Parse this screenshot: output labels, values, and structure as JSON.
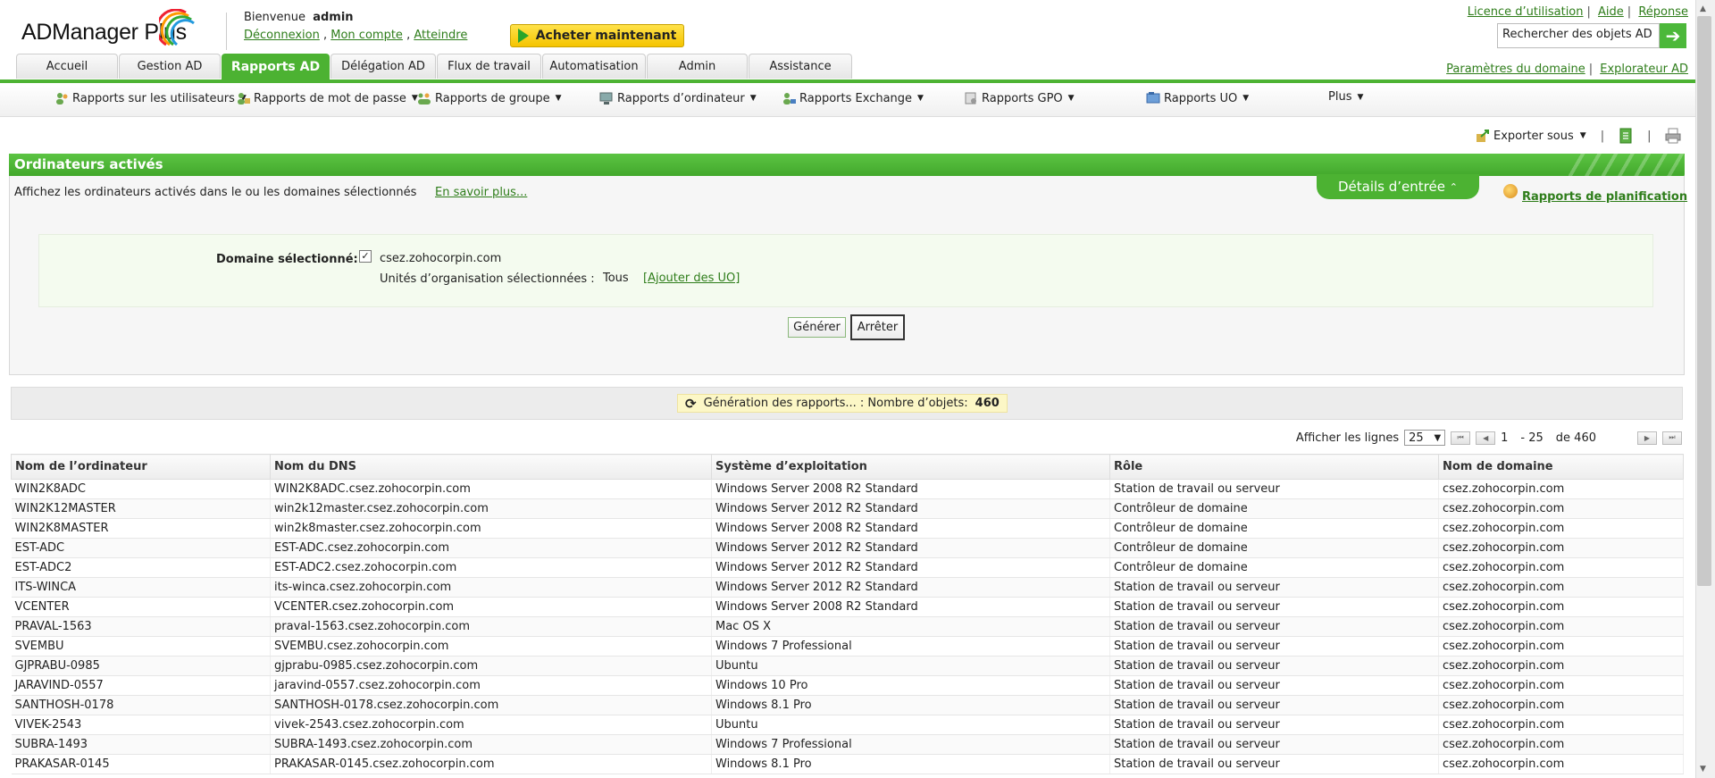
{
  "header": {
    "logo_text": "ADManager Plus",
    "welcome_label": "Bienvenue",
    "username": "admin",
    "user_links": [
      "Déconnexion",
      "Mon compte",
      "Atteindre"
    ],
    "buy_button": "Acheter maintenant",
    "top_links": [
      "Licence d’utilisation",
      "Aide",
      "Réponse"
    ],
    "search_placeholder": "Rechercher des objets AD",
    "domain_links": [
      "Paramètres du domaine",
      "Explorateur AD"
    ]
  },
  "tabs": [
    {
      "label": "Accueil",
      "active": false
    },
    {
      "label": "Gestion AD",
      "active": false
    },
    {
      "label": "Rapports AD",
      "active": true
    },
    {
      "label": "Délégation AD",
      "active": false
    },
    {
      "label": "Flux de travail",
      "active": false
    },
    {
      "label": "Automatisation",
      "active": false
    },
    {
      "label": "Admin",
      "active": false
    },
    {
      "label": "Assistance",
      "active": false
    }
  ],
  "subnav": [
    {
      "label": "Rapports sur les utilisateurs",
      "icon": "users-icon"
    },
    {
      "label": "Rapports de mot de passe",
      "icon": "password-icon"
    },
    {
      "label": "Rapports de groupe",
      "icon": "group-icon"
    },
    {
      "label": "Rapports d’ordinateur",
      "icon": "computer-icon"
    },
    {
      "label": "Rapports Exchange",
      "icon": "exchange-icon"
    },
    {
      "label": "Rapports GPO",
      "icon": "gpo-icon"
    },
    {
      "label": "Rapports UO",
      "icon": "ou-icon"
    },
    {
      "label": "Plus",
      "icon": ""
    }
  ],
  "toolbar": {
    "export_label": "Exporter sous"
  },
  "panel": {
    "title": "Ordinateurs activés",
    "description": "Affichez les ordinateurs activés dans le ou les domaines sélectionnés",
    "learn_more": "En savoir plus...",
    "details_tab": "Détails d’entrée",
    "schedule_link": "Rapports de planification",
    "domain_label": "Domaine sélectionné:",
    "domain_value": "csez.zohocorpin.com",
    "ou_label": "Unités d’organisation sélectionnées :",
    "ou_value": "Tous",
    "ou_link": "[Ajouter des UO]",
    "generate_button": "Générer",
    "stop_button": "Arrêter"
  },
  "status": {
    "text": "Génération des rapports... : Nombre d’objets:",
    "count": "460"
  },
  "paging": {
    "show_rows_label": "Afficher les lignes",
    "rows": "25",
    "from": "1",
    "to": "- 25",
    "total": "de 460"
  },
  "table": {
    "columns": [
      "Nom de l’ordinateur",
      "Nom du DNS",
      "Système d’exploitation",
      "Rôle",
      "Nom de domaine"
    ],
    "rows": [
      [
        "WIN2K8ADC",
        "WIN2K8ADC.csez.zohocorpin.com",
        "Windows Server 2008 R2 Standard",
        "Station de travail ou serveur",
        "csez.zohocorpin.com"
      ],
      [
        "WIN2K12MASTER",
        "win2k12master.csez.zohocorpin.com",
        "Windows Server 2012 R2 Standard",
        "Contrôleur de domaine",
        "csez.zohocorpin.com"
      ],
      [
        "WIN2K8MASTER",
        "win2k8master.csez.zohocorpin.com",
        "Windows Server 2008 R2 Standard",
        "Contrôleur de domaine",
        "csez.zohocorpin.com"
      ],
      [
        "EST-ADC",
        "EST-ADC.csez.zohocorpin.com",
        "Windows Server 2012 R2 Standard",
        "Contrôleur de domaine",
        "csez.zohocorpin.com"
      ],
      [
        "EST-ADC2",
        "EST-ADC2.csez.zohocorpin.com",
        "Windows Server 2012 R2 Standard",
        "Contrôleur de domaine",
        "csez.zohocorpin.com"
      ],
      [
        "ITS-WINCA",
        "its-winca.csez.zohocorpin.com",
        "Windows Server 2012 R2 Standard",
        "Station de travail ou serveur",
        "csez.zohocorpin.com"
      ],
      [
        "VCENTER",
        "VCENTER.csez.zohocorpin.com",
        "Windows Server 2008 R2 Standard",
        "Station de travail ou serveur",
        "csez.zohocorpin.com"
      ],
      [
        "PRAVAL-1563",
        "praval-1563.csez.zohocorpin.com",
        "Mac OS X",
        "Station de travail ou serveur",
        "csez.zohocorpin.com"
      ],
      [
        "SVEMBU",
        "SVEMBU.csez.zohocorpin.com",
        "Windows 7 Professional",
        "Station de travail ou serveur",
        "csez.zohocorpin.com"
      ],
      [
        "GJPRABU-0985",
        "gjprabu-0985.csez.zohocorpin.com",
        "Ubuntu",
        "Station de travail ou serveur",
        "csez.zohocorpin.com"
      ],
      [
        "JARAVIND-0557",
        "jaravind-0557.csez.zohocorpin.com",
        "Windows 10 Pro",
        "Station de travail ou serveur",
        "csez.zohocorpin.com"
      ],
      [
        "SANTHOSH-0178",
        "SANTHOSH-0178.csez.zohocorpin.com",
        "Windows 8.1 Pro",
        "Station de travail ou serveur",
        "csez.zohocorpin.com"
      ],
      [
        "VIVEK-2543",
        "vivek-2543.csez.zohocorpin.com",
        "Ubuntu",
        "Station de travail ou serveur",
        "csez.zohocorpin.com"
      ],
      [
        "SUBRA-1493",
        "SUBRA-1493.csez.zohocorpin.com",
        "Windows 7 Professional",
        "Station de travail ou serveur",
        "csez.zohocorpin.com"
      ],
      [
        "PRAKASAR-0145",
        "PRAKASAR-0145.csez.zohocorpin.com",
        "Windows 8.1 Pro",
        "Station de travail ou serveur",
        "csez.zohocorpin.com"
      ]
    ]
  },
  "colors": {
    "accent": "#4cb232",
    "link": "#2e7d1a",
    "buy": "#f5c400",
    "status_bg": "#fcf7c6"
  }
}
